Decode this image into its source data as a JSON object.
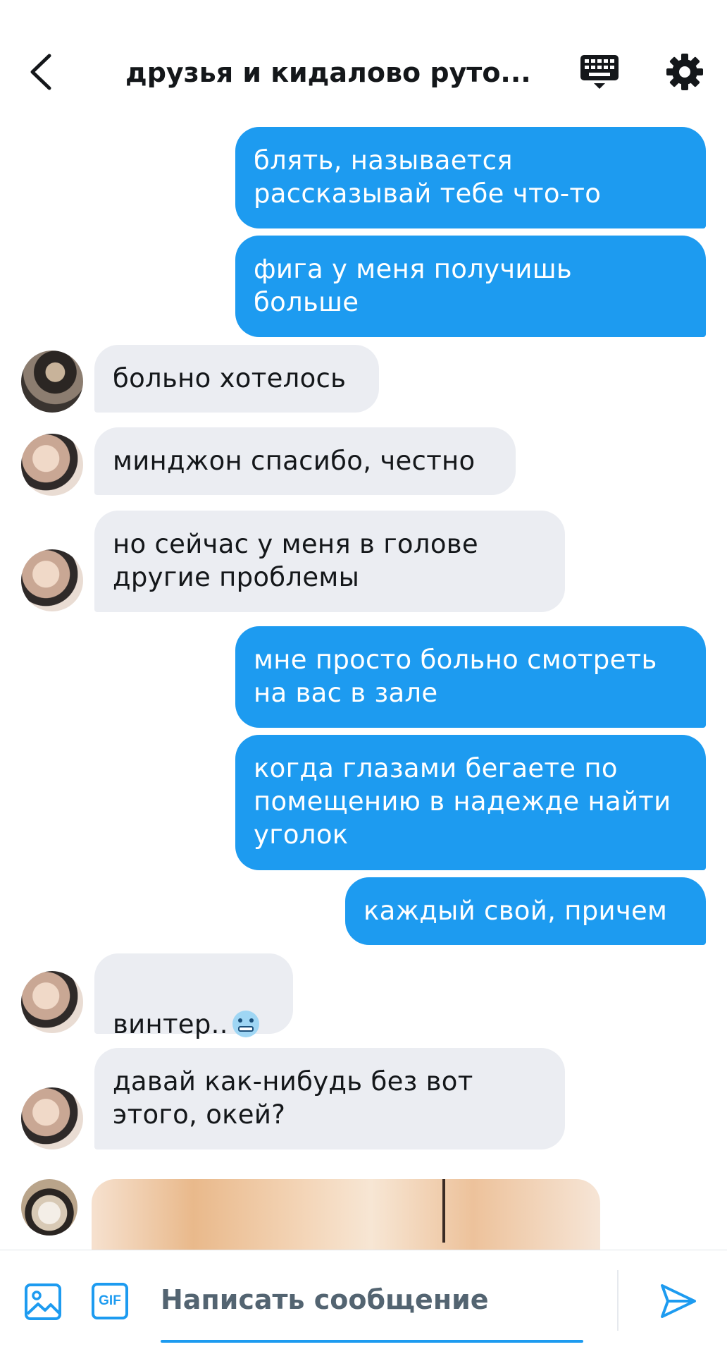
{
  "header": {
    "title": "друзья и кидалово руто..."
  },
  "messages": [
    {
      "side": "out",
      "text": "блять, называется\nрассказывай тебе что-то"
    },
    {
      "side": "out",
      "text": "фига у меня получишь\nбольше"
    },
    {
      "side": "in",
      "text": "больно хотелось"
    },
    {
      "side": "in",
      "text": "минджон спасибо, честно"
    },
    {
      "side": "in",
      "text": "но сейчас у меня в голове\nдругие проблемы"
    },
    {
      "side": "out",
      "text": "мне просто больно смотреть\nна вас в зале"
    },
    {
      "side": "out",
      "text": "когда глазами бегаете по\nпомещению в надежде найти\nуголок"
    },
    {
      "side": "out",
      "text": "каждый свой, причем"
    },
    {
      "side": "in",
      "text": "винтер..",
      "emoji": "cold-face-emoji"
    },
    {
      "side": "in",
      "text": "давай как-нибудь без вот\nэтого, окей?"
    }
  ],
  "composer": {
    "placeholder": "Написать сообщение",
    "gif_label": "GIF"
  },
  "colors": {
    "accent": "#1d9bf0",
    "incoming_bubble": "#ebedf2",
    "text_dark": "#14171a"
  }
}
